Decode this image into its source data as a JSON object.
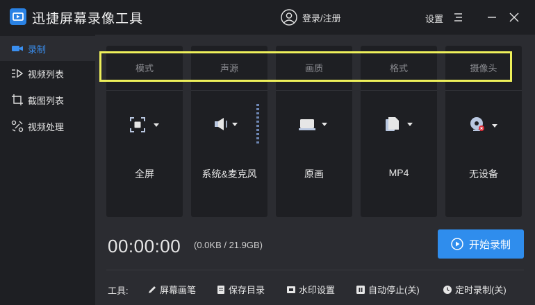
{
  "app": {
    "title": "迅捷屏幕录像工具",
    "login": "登录/注册",
    "settings": "设置"
  },
  "sidebar": {
    "items": [
      {
        "label": "录制",
        "icon": "camera-icon",
        "active": true
      },
      {
        "label": "视频列表",
        "icon": "video-list-icon",
        "active": false
      },
      {
        "label": "截图列表",
        "icon": "screenshot-list-icon",
        "active": false
      },
      {
        "label": "视频处理",
        "icon": "video-process-icon",
        "active": false
      }
    ]
  },
  "options": [
    {
      "header": "模式",
      "value": "全屏",
      "icon": "fullscreen-icon"
    },
    {
      "header": "声源",
      "value": "系统&麦克风",
      "icon": "speaker-icon"
    },
    {
      "header": "画质",
      "value": "原画",
      "icon": "monitor-icon"
    },
    {
      "header": "格式",
      "value": "MP4",
      "icon": "file-icon"
    },
    {
      "header": "摄像头",
      "value": "无设备",
      "icon": "webcam-icon"
    }
  ],
  "recording": {
    "timer": "00:00:00",
    "size": "(0.0KB / 21.9GB)",
    "start_label": "开始录制"
  },
  "tools": {
    "label": "工具:",
    "items": [
      {
        "label": "屏幕画笔",
        "icon": "pen-icon"
      },
      {
        "label": "保存目录",
        "icon": "folder-icon"
      },
      {
        "label": "水印设置",
        "icon": "watermark-icon"
      },
      {
        "label": "自动停止(关)",
        "icon": "pause-icon"
      },
      {
        "label": "定时录制(关)",
        "icon": "clock-icon"
      }
    ]
  },
  "colors": {
    "accent": "#2f8ded",
    "highlight": "#eef05a",
    "background": "#1e1f23",
    "panel": "#2b2c31"
  }
}
